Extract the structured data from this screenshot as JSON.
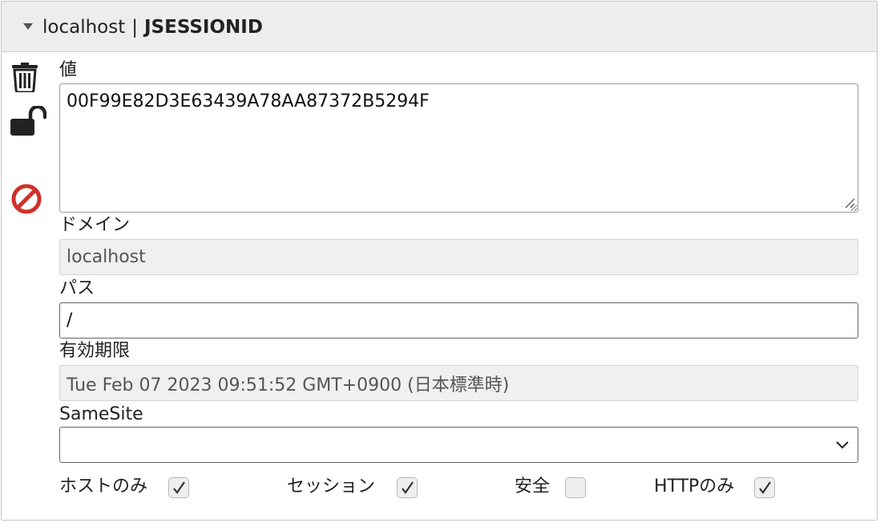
{
  "header": {
    "host": "localhost",
    "separator": "|",
    "cookie_name": "JSESSIONID",
    "expanded": true
  },
  "actions": {
    "delete_icon": "trash-icon",
    "lock_icon": "unlocked-padlock-icon",
    "block_icon": "prohibited-icon"
  },
  "fields": {
    "value": {
      "label": "値",
      "value": "00F99E82D3E63439A78AA87372B5294F"
    },
    "domain": {
      "label": "ドメイン",
      "value": "localhost",
      "readonly": true
    },
    "path": {
      "label": "パス",
      "value": "/"
    },
    "expiration": {
      "label": "有効期限",
      "value": "Tue Feb 07 2023 09:51:52 GMT+0900 (日本標準時)",
      "readonly": true
    },
    "samesite": {
      "label": "SameSite",
      "value": ""
    }
  },
  "checkboxes": [
    {
      "label": "ホストのみ",
      "checked": true
    },
    {
      "label": "セッション",
      "checked": true
    },
    {
      "label": "安全",
      "checked": false
    },
    {
      "label": "HTTPのみ",
      "checked": true
    }
  ],
  "colors": {
    "header_bg": "#ededed",
    "block_icon": "#d0302a",
    "icon_dark": "#222222"
  }
}
